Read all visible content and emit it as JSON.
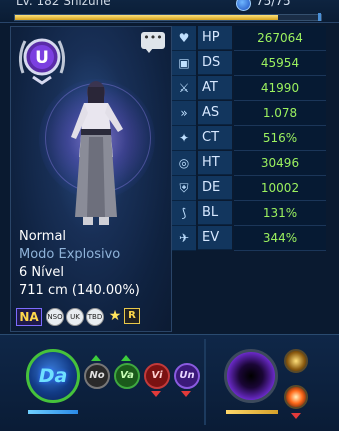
{
  "topbar": {
    "character_name": "Lv. 182 Shizune",
    "orb_value": "75/75",
    "xp_fraction": 0.86
  },
  "portrait": {
    "chat_icon": "speech-bubble-icon",
    "emblem_letter": "U"
  },
  "info": {
    "status": "Normal",
    "mode": "Modo Explosivo",
    "level": "6 Nível",
    "height": "711 cm (140.00%)"
  },
  "tags": {
    "na": "NA",
    "nso": "NSO",
    "uk": "UK",
    "tbd": "TBD",
    "star": "★",
    "r": "R"
  },
  "stats": [
    {
      "icon": "heart-icon",
      "glyph": "♥",
      "label": "HP",
      "value": "267064"
    },
    {
      "icon": "shield-arm-icon",
      "glyph": "▣",
      "label": "DS",
      "value": "45954"
    },
    {
      "icon": "sword-icon",
      "glyph": "⚔",
      "label": "AT",
      "value": "41990"
    },
    {
      "icon": "wing-icon",
      "glyph": "»",
      "label": "AS",
      "value": "1.078"
    },
    {
      "icon": "claw-icon",
      "glyph": "✦",
      "label": "CT",
      "value": "516%"
    },
    {
      "icon": "target-icon",
      "glyph": "◎",
      "label": "HT",
      "value": "30496"
    },
    {
      "icon": "shield-icon",
      "glyph": "⛨",
      "label": "DE",
      "value": "10002"
    },
    {
      "icon": "block-icon",
      "glyph": "⟆",
      "label": "BL",
      "value": "131%"
    },
    {
      "icon": "evade-icon",
      "glyph": "✈",
      "label": "EV",
      "value": "344%"
    }
  ],
  "skills": {
    "main": "Da",
    "attrs": [
      {
        "label": "No"
      },
      {
        "label": "Va"
      },
      {
        "label": "Vi"
      },
      {
        "label": "Un"
      }
    ]
  }
}
